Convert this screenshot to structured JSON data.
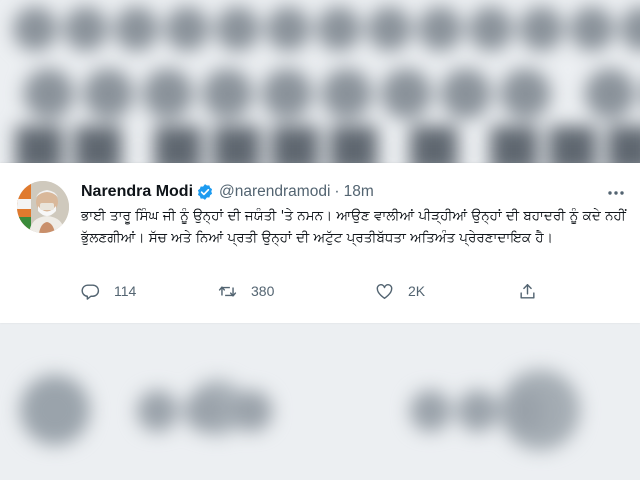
{
  "tweet": {
    "author": {
      "display_name": "Narendra Modi",
      "handle": "@narendramodi",
      "verified": true,
      "avatar": "person-portrait-avatar"
    },
    "separator": "·",
    "timestamp": "18m",
    "text": "ਭਾਈ ਤਾਰੂ ਸਿੰਘ ਜੀ ਨੂੰ ਉਨ੍ਹਾਂ ਦੀ ਜਯੰਤੀ 'ਤੇ ਨਮਨ। ਆਉਣ ਵਾਲੀਆਂ ਪੀੜ੍ਹੀਆਂ ਉਨ੍ਹਾਂ ਦੀ ਬਹਾਦਰੀ ਨੂੰ ਕਦੇ ਨਹੀਂ ਭੁੱਲਣਗੀਆਂ। ਸੱਚ ਅਤੇ ਨਿਆਂ ਪ੍ਰਤੀ ਉਨ੍ਹਾਂ ਦੀ ਅਟੁੱਟ ਪ੍ਰਤੀਬੱਧਤਾ ਅਤਿਅੰਤ ਪ੍ਰੇਰਣਾਦਾਇਕ ਹੈ।",
    "actions": {
      "reply": {
        "icon": "reply-icon",
        "count": "114"
      },
      "retweet": {
        "icon": "retweet-icon",
        "count": "380"
      },
      "like": {
        "icon": "heart-icon",
        "count": "2K"
      },
      "share": {
        "icon": "share-icon",
        "count": ""
      }
    },
    "menu_icon": "more-options-icon"
  },
  "colors": {
    "text_primary": "#0f1419",
    "text_secondary": "#536471",
    "verified_badge": "#1d9bf0",
    "card_background": "#ffffff",
    "blurred_background": "#eceff2"
  }
}
